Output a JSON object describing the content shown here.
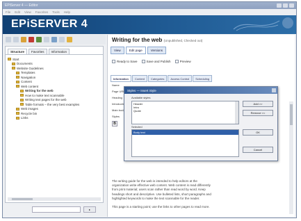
{
  "app": {
    "brand": "EPiSERVER 4",
    "window_title": "EPiServer 4 — Editor",
    "menu": [
      "File",
      "Edit",
      "View",
      "Favorites",
      "Tools",
      "Help"
    ]
  },
  "tree": {
    "tabs": [
      "Structure",
      "Favorites",
      "Information"
    ],
    "nodes": [
      {
        "label": "Start",
        "indent": 0
      },
      {
        "label": "Documents",
        "indent": 1
      },
      {
        "label": "Website Guidelines",
        "indent": 1
      },
      {
        "label": "Templates",
        "indent": 2
      },
      {
        "label": "Navigation",
        "indent": 2
      },
      {
        "label": "Content",
        "indent": 2
      },
      {
        "label": "Web content",
        "indent": 2
      },
      {
        "label": "Writing for the web",
        "indent": 3,
        "selected": true
      },
      {
        "label": "How to make text scannable",
        "indent": 3
      },
      {
        "label": "Writing text pages for the web",
        "indent": 3
      },
      {
        "label": "Table formats – the very best examples",
        "indent": 3
      },
      {
        "label": "Web images",
        "indent": 2
      },
      {
        "label": "Recycle bin",
        "indent": 2
      },
      {
        "label": "Links",
        "indent": 2
      }
    ]
  },
  "main": {
    "title": "Writing for the web",
    "title_meta": "(Unpublished, Checked out)",
    "tabs": [
      "View",
      "Edit page",
      "Versions"
    ],
    "checkboxes": [
      "Ready to Save",
      "Save and Publish",
      "Preview"
    ],
    "prop_tabs": [
      "Information",
      "Content",
      "Categories",
      "Access Control",
      "Scheduling"
    ],
    "field_labels": [
      "Name",
      "Page URL",
      "Heading",
      "Introduction",
      "Main body",
      "Styles"
    ],
    "body_lines": [
      "The writing guide for the web is intended to help editors at the",
      "organization write effective web content. Web content is read differently",
      "from print material; users scan rather than read word by word. Keep",
      "headings short and descriptive. Use bulleted lists, short paragraphs and",
      "highlighted keywords to make the text scannable for the reader.",
      "",
      "This page is a starting point; use the links to other pages to read more."
    ]
  },
  "dialog": {
    "title": "Styles — Insert Style",
    "label_available": "Available styles",
    "label_selected": "Selected",
    "available": [
      "Header",
      "Intro",
      "Quote"
    ],
    "selected_item": "Body text",
    "buttons": [
      "Add >>",
      "Remove <<",
      "OK",
      "Cancel"
    ]
  },
  "colors": {
    "banner": "#1f5a93",
    "highlight": "#f2e84a",
    "selection": "#2f5fa8"
  }
}
